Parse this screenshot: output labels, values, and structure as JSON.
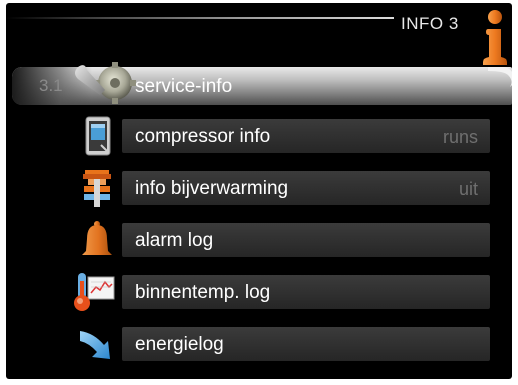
{
  "header": {
    "title": "INFO 3"
  },
  "menu": {
    "number": "3.1",
    "title": "service-info",
    "items": [
      {
        "label": "compressor info",
        "value": "runs",
        "icon": "compressor-icon"
      },
      {
        "label": "info bijverwarming",
        "value": "uit",
        "icon": "heater-icon"
      },
      {
        "label": "alarm log",
        "value": "",
        "icon": "bell-icon"
      },
      {
        "label": "binnentemp. log",
        "value": "",
        "icon": "thermometer-graph-icon"
      },
      {
        "label": "energielog",
        "value": "",
        "icon": "energy-arrow-icon"
      }
    ]
  },
  "colors": {
    "accent": "#e8731b",
    "background": "#000000",
    "text": "#ffffff",
    "muted": "#6f6f6f"
  }
}
